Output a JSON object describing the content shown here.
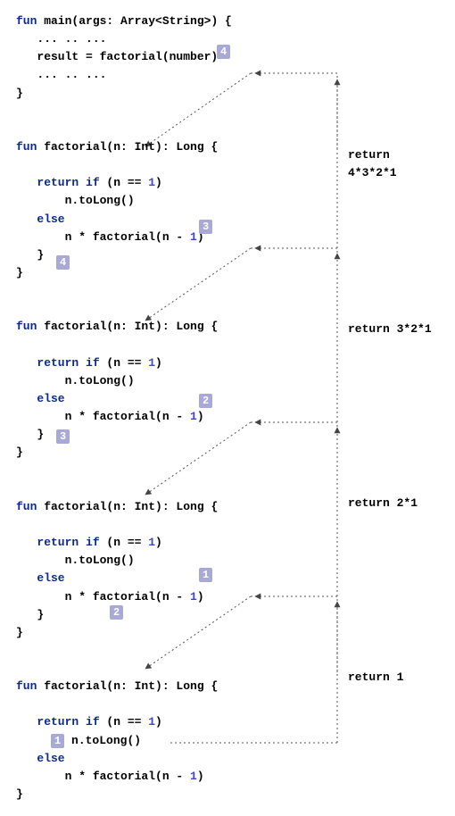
{
  "main": {
    "sig_fun": "fun",
    "sig_name": " main(args: Array<String>) {",
    "dots1": "   ... .. ...",
    "result_lhs": "   result = factorial(number)",
    "dots2": "   ... .. ...",
    "close": "}"
  },
  "calls": [
    {
      "sig_fun": "fun",
      "sig_rest": " factorial(n: Int): Long {",
      "ret_if": "return if",
      "ret_cond_open": " (n == ",
      "ret_cond_one": "1",
      "ret_cond_close": ")",
      "tolong": "       n.toLong()",
      "else_kw": "else",
      "rec_pref": "       n * factorial(n - ",
      "rec_one": "1",
      "rec_close": ")",
      "close_inner": "   }",
      "close_outer": "}",
      "annotation": "return 4*3*2*1",
      "badge_arg": "3",
      "badge_ret": "4"
    },
    {
      "sig_fun": "fun",
      "sig_rest": " factorial(n: Int): Long {",
      "ret_if": "return if",
      "ret_cond_open": " (n == ",
      "ret_cond_one": "1",
      "ret_cond_close": ")",
      "tolong": "       n.toLong()",
      "else_kw": "else",
      "rec_pref": "       n * factorial(n - ",
      "rec_one": "1",
      "rec_close": ")",
      "close_inner": "   }",
      "close_outer": "}",
      "annotation": "return 3*2*1",
      "badge_arg": "2",
      "badge_ret": "3"
    },
    {
      "sig_fun": "fun",
      "sig_rest": " factorial(n: Int): Long {",
      "ret_if": "return if",
      "ret_cond_open": " (n == ",
      "ret_cond_one": "1",
      "ret_cond_close": ")",
      "tolong": "       n.toLong()",
      "else_kw": "else",
      "rec_pref": "       n * factorial(n - ",
      "rec_one": "1",
      "rec_close": ")",
      "close_inner": "   }",
      "close_outer": "}",
      "annotation": "return 2*1",
      "badge_arg": "1",
      "badge_ret": "2"
    }
  ],
  "base": {
    "sig_fun": "fun",
    "sig_rest": " factorial(n: Int): Long {",
    "ret_if": "return if",
    "ret_cond_open": " (n == ",
    "ret_cond_one": "1",
    "ret_cond_close": ")",
    "tolong": "n.toLong()",
    "else_kw": "else",
    "rec_pref": "       n * factorial(n - ",
    "rec_one": "1",
    "rec_close": ")",
    "close_outer": "}",
    "annotation": "return 1",
    "badge_ret": "1"
  }
}
